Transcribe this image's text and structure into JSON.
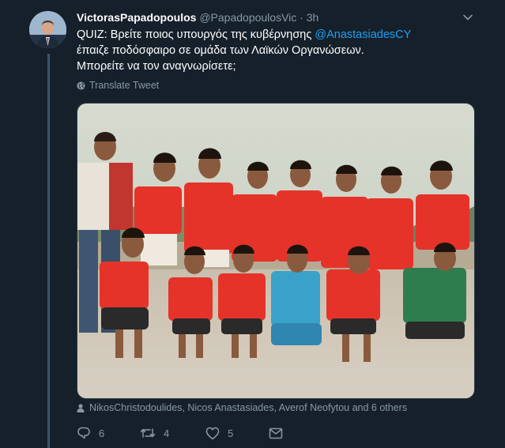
{
  "tweet": {
    "display_name": "VictorasPapadopoulos",
    "handle": "@PapadopoulosVic",
    "separator": "·",
    "time": "3h",
    "text_part1": "QUIZ: Βρείτε ποιος υπουργός της κυβέρνησης ",
    "mention": "@AnastasiadesCY",
    "text_part2": " έπαιζε ποδόσφαιρο σε ομάδα των Λαϊκών Οργανώσεων.",
    "text_line2": "Μπορείτε να τον αναγνωρίσετε;",
    "translate_label": "Translate Tweet",
    "tagged_people": "NikosChristodoulides, Nicos Anastasiades, Averof Neofytou and 6 others",
    "reply_count": "6",
    "retweet_count": "4",
    "like_count": "5"
  },
  "icons": {
    "chevron": "chevron-down-icon",
    "globe": "globe-icon",
    "person": "person-icon",
    "reply": "reply-icon",
    "retweet": "retweet-icon",
    "like": "heart-icon",
    "dm": "envelope-icon"
  },
  "colors": {
    "background": "#15202b",
    "accent": "#1da1f2",
    "secondary_text": "#8899a6",
    "jersey_red": "#e5332a"
  }
}
